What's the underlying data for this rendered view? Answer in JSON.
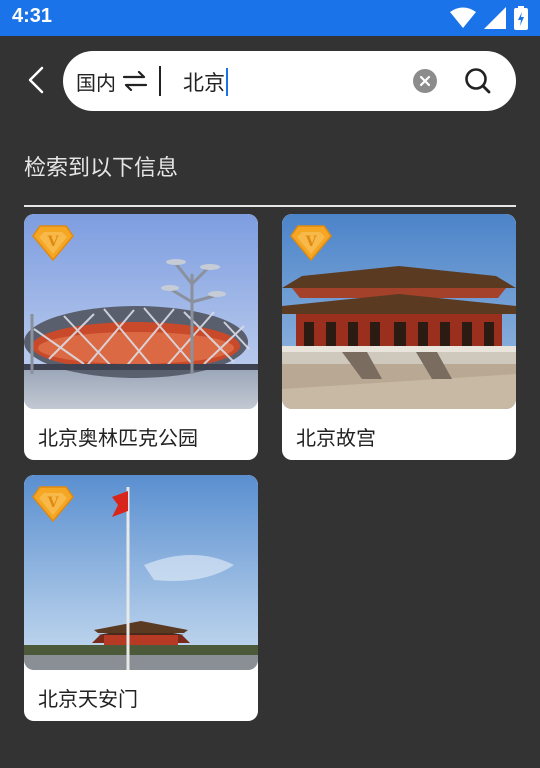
{
  "status_bar": {
    "time": "4:31",
    "icons": [
      "wifi-icon",
      "signal-icon",
      "battery-charging-icon"
    ],
    "color": "#1a73e8"
  },
  "search": {
    "scope_label": "国内",
    "query": "北京",
    "icons": [
      "back-arrow-icon",
      "swap-icon",
      "clear-icon",
      "search-icon"
    ]
  },
  "results": {
    "header": "检索到以下信息",
    "items": [
      {
        "title": "北京奥林匹克公园",
        "badge": "V"
      },
      {
        "title": "北京故宫",
        "badge": "V"
      },
      {
        "title": "北京天安门",
        "badge": "V"
      }
    ]
  },
  "colors": {
    "background": "#333333",
    "accent": "#1a73e8",
    "badge": "#f5a623"
  }
}
